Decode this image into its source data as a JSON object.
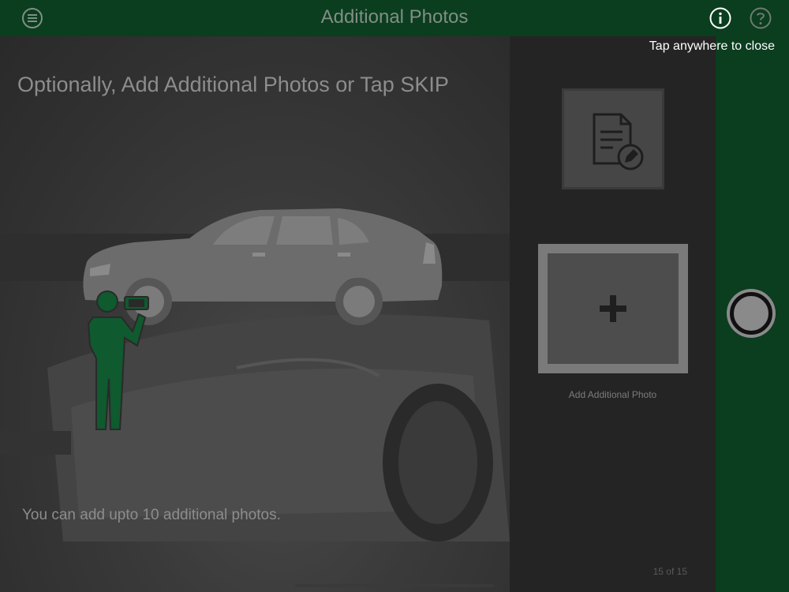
{
  "header": {
    "title": "Additional Photos",
    "menu_icon": "menu-icon",
    "info_icon": "info-icon",
    "help_icon": "help-icon"
  },
  "overlay": {
    "close_hint": "Tap anywhere to close"
  },
  "preview": {
    "headline": "Optionally, Add Additional Photos or Tap SKIP",
    "footnote": "You can add  upto 10 additional photos."
  },
  "thumbnails": {
    "form_icon": "document-edit-icon",
    "add_icon": "plus-icon",
    "add_label": "Add Additional Photo",
    "counter": "15 of 15"
  },
  "capture": {
    "shutter_icon": "shutter-icon"
  },
  "colors": {
    "brand_green": "#0b3d1f",
    "guide_person_green": "#0f5a2e"
  }
}
